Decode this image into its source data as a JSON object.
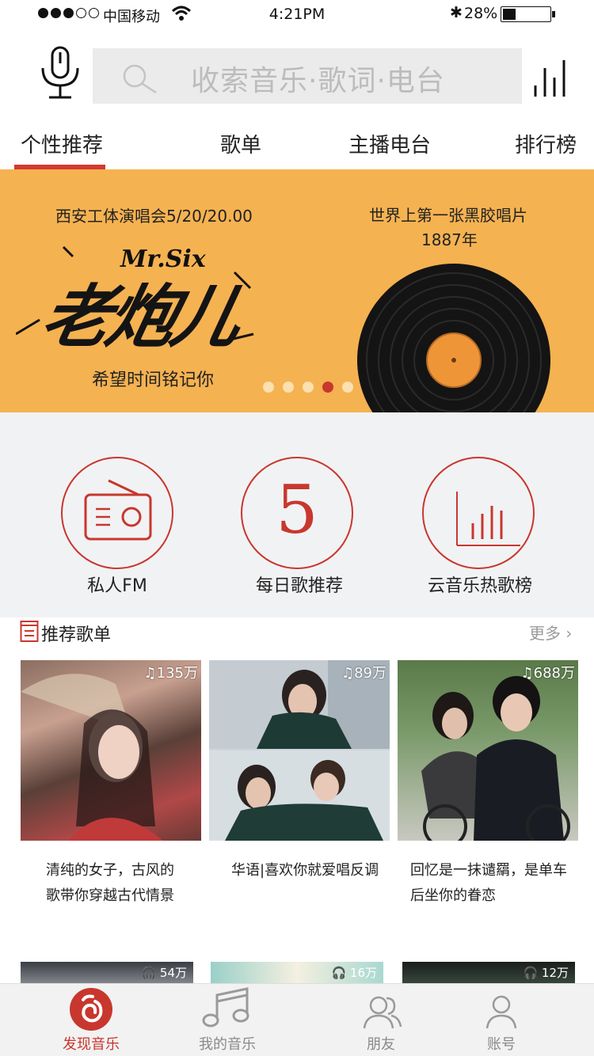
{
  "status_bar": {
    "carrier": "中国移动",
    "time": "4:21PM",
    "bluetooth": "✱",
    "battery_pct": "28%",
    "battery_level": 0.28,
    "signal_filled": 3,
    "signal_total": 5
  },
  "header": {
    "search_placeholder": "收索音乐·歌词·电台"
  },
  "tabs": [
    {
      "label": "个性推荐",
      "active": true
    },
    {
      "label": "歌单",
      "active": false
    },
    {
      "label": "主播电台",
      "active": false
    },
    {
      "label": "排行榜",
      "active": false
    }
  ],
  "banner": {
    "left_title": "西安工体演唱会5/20/20.00",
    "logo_en": "Mr.Six",
    "logo_cn": "老炮儿",
    "left_sub": "希望时间铭记你",
    "right_title": "世界上第一张黑胶唱片",
    "right_year": "1887年",
    "page_count": 5,
    "active_page": 4
  },
  "shortcuts": [
    {
      "label": "私人FM",
      "icon": "radio-icon"
    },
    {
      "label": "每日歌推荐",
      "icon": "calendar-5-icon",
      "glyph": "5"
    },
    {
      "label": "云音乐热歌榜",
      "icon": "chart-icon"
    }
  ],
  "recommend": {
    "title": "推荐歌单",
    "more": "更多"
  },
  "playlists": [
    {
      "count": "135万",
      "line1": "清纯的女子，古风的",
      "line2": "歌带你穿越古代情景"
    },
    {
      "count": "89万",
      "line1": "华语|喜欢你就爱唱反调",
      "line2": ""
    },
    {
      "count": "688万",
      "line1": "回忆是一抹谴羂，是单车",
      "line2": "后坐你的眷恋"
    }
  ],
  "playlists_row2": [
    {
      "count": "54万"
    },
    {
      "count": "16万"
    },
    {
      "count": "12万"
    }
  ],
  "tabbar": [
    {
      "label": "发现音乐",
      "active": true
    },
    {
      "label": "我的音乐",
      "active": false
    },
    {
      "label": "朋友",
      "active": false
    },
    {
      "label": "账号",
      "active": false
    }
  ],
  "colors": {
    "accent": "#c8372d",
    "banner_bg": "#f5b251"
  }
}
